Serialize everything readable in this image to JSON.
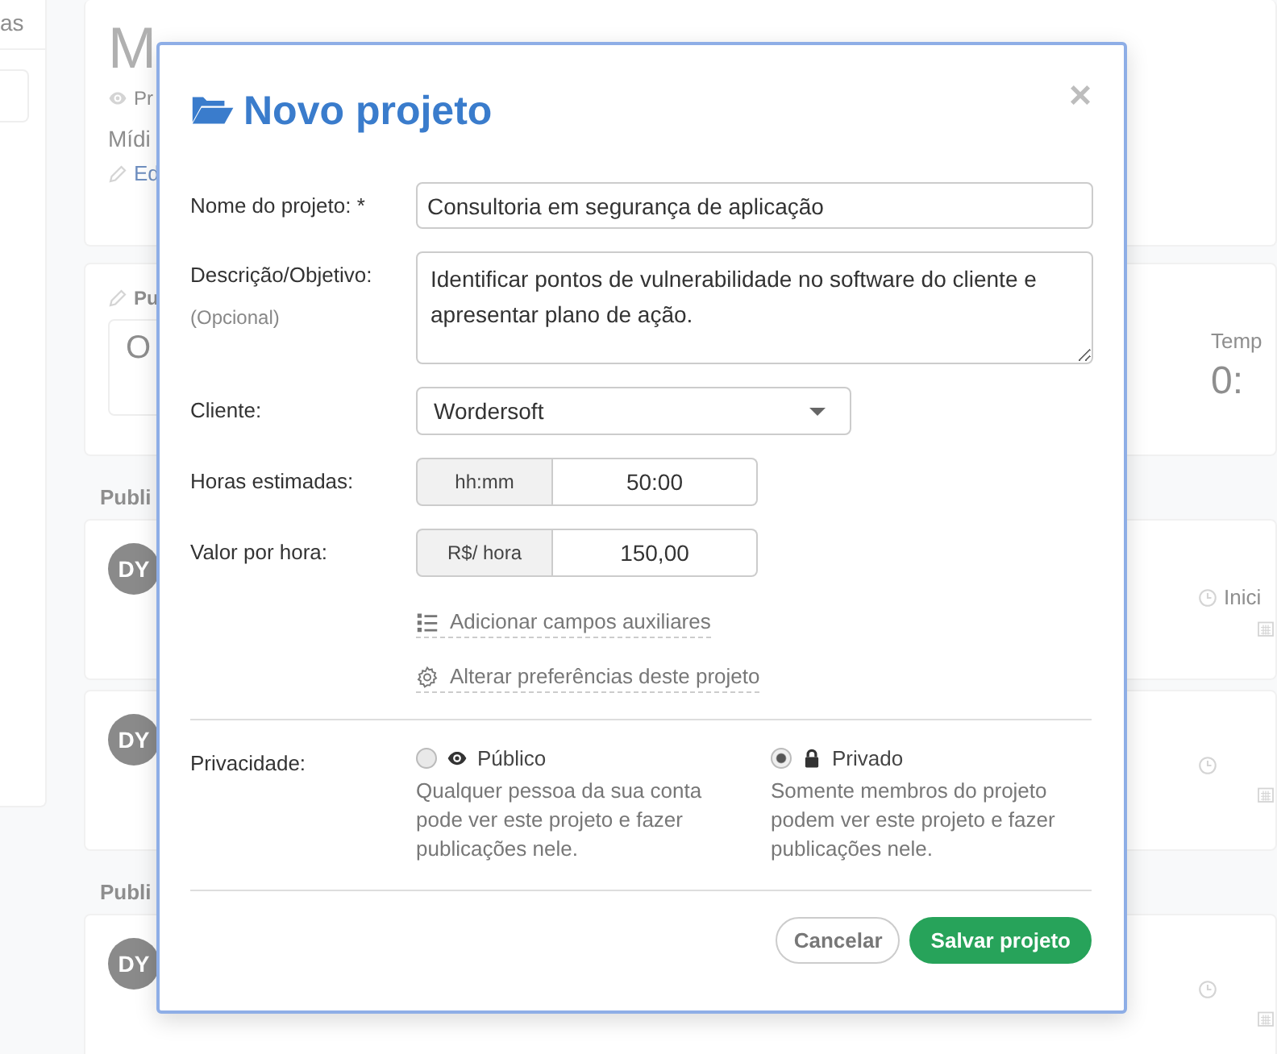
{
  "background": {
    "sidebar_tab": "as",
    "title": "M",
    "visibility": "Pr",
    "subtitle": "Mídi",
    "edit_link": "Ed",
    "post_label": "Pu",
    "post_placeholder": "O",
    "timer_label": "Temp",
    "timer_value": "0:",
    "sections": [
      {
        "heading": "Publi",
        "posts": [
          {
            "avatar": "DY",
            "meta": "Inici"
          },
          {
            "avatar": "DY"
          }
        ]
      },
      {
        "heading": "Publi",
        "posts": [
          {
            "avatar": "DY"
          }
        ]
      }
    ]
  },
  "dialog": {
    "title": "Novo projeto",
    "close": "×",
    "name": {
      "label": "Nome do projeto: *",
      "value": "Consultoria em segurança de aplicação"
    },
    "description": {
      "label": "Descrição/Objetivo:",
      "hint": "(Opcional)",
      "value": "Identificar pontos de vulnerabilidade no software do cliente e apresentar plano de ação."
    },
    "client": {
      "label": "Cliente:",
      "value": "Wordersoft"
    },
    "hours": {
      "label": "Horas estimadas:",
      "addon": "hh:mm",
      "value": "50:00"
    },
    "rate": {
      "label": "Valor por hora:",
      "addon": "R$/ hora",
      "value": "150,00"
    },
    "links": [
      {
        "kind": "list",
        "label": "Adicionar campos auxiliares"
      },
      {
        "kind": "gear",
        "label": "Alterar preferências deste projeto"
      }
    ],
    "privacy": {
      "label": "Privacidade:",
      "options": [
        {
          "kind": "eye",
          "label": "Público",
          "description": "Qualquer pessoa da sua conta pode ver este projeto e fazer publicações nele.",
          "selected": false
        },
        {
          "kind": "lock",
          "label": "Privado",
          "description": "Somente membros do projeto podem ver este projeto e fazer publicações nele.",
          "selected": true
        }
      ]
    },
    "buttons": [
      {
        "kind": "secondary",
        "label": "Cancelar"
      },
      {
        "kind": "primary",
        "label": "Salvar projeto"
      }
    ]
  }
}
